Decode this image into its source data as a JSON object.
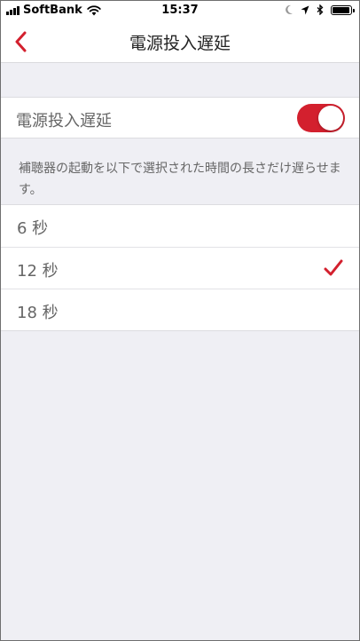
{
  "status_bar": {
    "carrier": "SoftBank",
    "time": "15:37",
    "battery_level": 0.95
  },
  "nav": {
    "title": "電源投入遅延"
  },
  "toggle": {
    "label": "電源投入遅延",
    "on": true,
    "accent_color": "#d3202e"
  },
  "description": "補聴器の起動を以下で選択された時間の長さだけ遅らせます。",
  "options": [
    {
      "label": "6 秒",
      "selected": false
    },
    {
      "label": "12 秒",
      "selected": true
    },
    {
      "label": "18 秒",
      "selected": false
    }
  ],
  "icons": {
    "back": "chevron-left-icon",
    "check": "checkmark-icon"
  }
}
